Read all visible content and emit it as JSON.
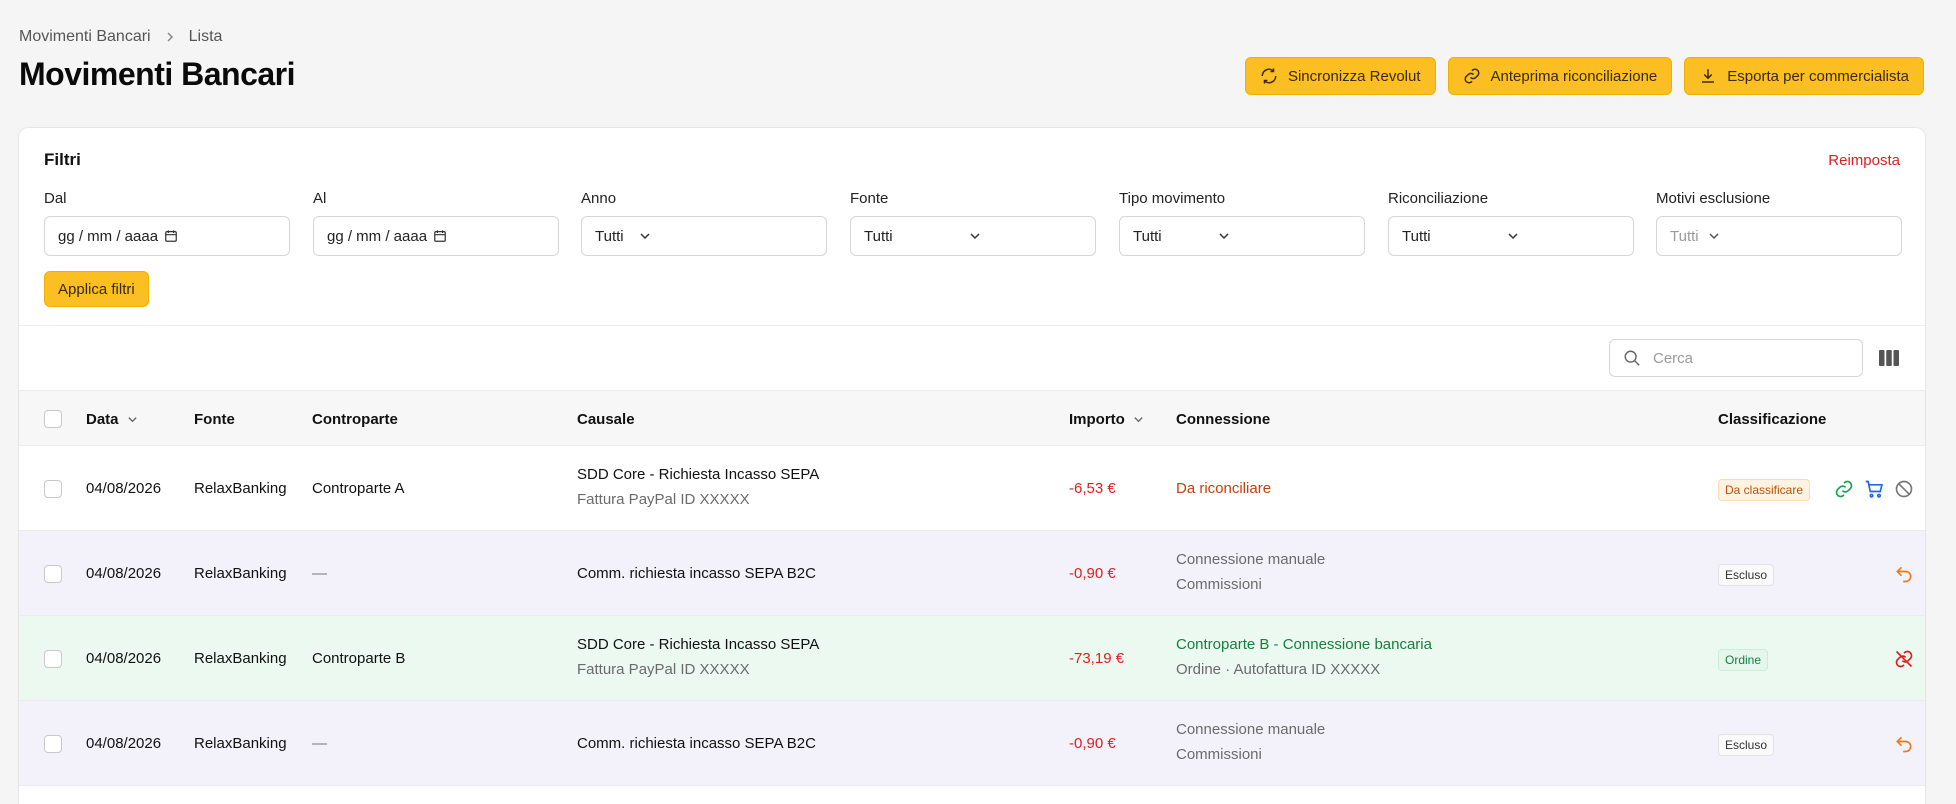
{
  "breadcrumb": {
    "parent": "Movimenti Bancari",
    "current": "Lista"
  },
  "page_title": "Movimenti Bancari",
  "actions": {
    "sync": "Sincronizza Revolut",
    "preview": "Anteprima riconciliazione",
    "export": "Esporta per commercialista"
  },
  "filters": {
    "title": "Filtri",
    "reset": "Reimposta",
    "from": {
      "label": "Dal",
      "placeholder": "gg / mm / aaaa"
    },
    "to": {
      "label": "Al",
      "placeholder": "gg / mm / aaaa"
    },
    "year": {
      "label": "Anno",
      "value": "Tutti"
    },
    "source": {
      "label": "Fonte",
      "value": "Tutti"
    },
    "type": {
      "label": "Tipo movimento",
      "value": "Tutti"
    },
    "reconciliation": {
      "label": "Riconciliazione",
      "value": "Tutti"
    },
    "exclusion": {
      "label": "Motivi esclusione",
      "value": "Tutti"
    },
    "apply": "Applica filtri"
  },
  "search": {
    "placeholder": "Cerca"
  },
  "table": {
    "headers": {
      "date": "Data",
      "source": "Fonte",
      "counterpart": "Controparte",
      "reason": "Causale",
      "amount": "Importo",
      "connection": "Connessione",
      "classification": "Classificazione"
    },
    "rows": [
      {
        "date": "04/08/2026",
        "source": "RelaxBanking",
        "counterpart": "Controparte A",
        "reason": "SDD Core - Richiesta Incasso SEPA",
        "reason2": "Fattura PayPal ID XXXXX",
        "amount": "-6,53 €",
        "connection": "Da riconciliare",
        "connection2": "",
        "classification": "Da classificare"
      },
      {
        "date": "04/08/2026",
        "source": "RelaxBanking",
        "counterpart": "—",
        "reason": "Comm. richiesta incasso SEPA B2C",
        "reason2": "",
        "amount": "-0,90 €",
        "connection": "Connessione manuale",
        "connection2": "Commissioni",
        "classification": "Escluso"
      },
      {
        "date": "04/08/2026",
        "source": "RelaxBanking",
        "counterpart": "Controparte B",
        "reason": "SDD Core - Richiesta Incasso SEPA",
        "reason2": "Fattura PayPal ID XXXXX",
        "amount": "-73,19 €",
        "connection": "Controparte B - Connessione bancaria",
        "connection2": "Ordine · Autofattura ID XXXXX",
        "classification": "Ordine"
      },
      {
        "date": "04/08/2026",
        "source": "RelaxBanking",
        "counterpart": "—",
        "reason": "Comm. richiesta incasso SEPA B2C",
        "reason2": "",
        "amount": "-0,90 €",
        "connection": "Connessione manuale",
        "connection2": "Commissioni",
        "classification": "Escluso"
      }
    ]
  },
  "colors": {
    "accent": "#fbbf24",
    "negative": "#dc1f1f",
    "pending": "#c2410c",
    "connected": "#15803d"
  }
}
